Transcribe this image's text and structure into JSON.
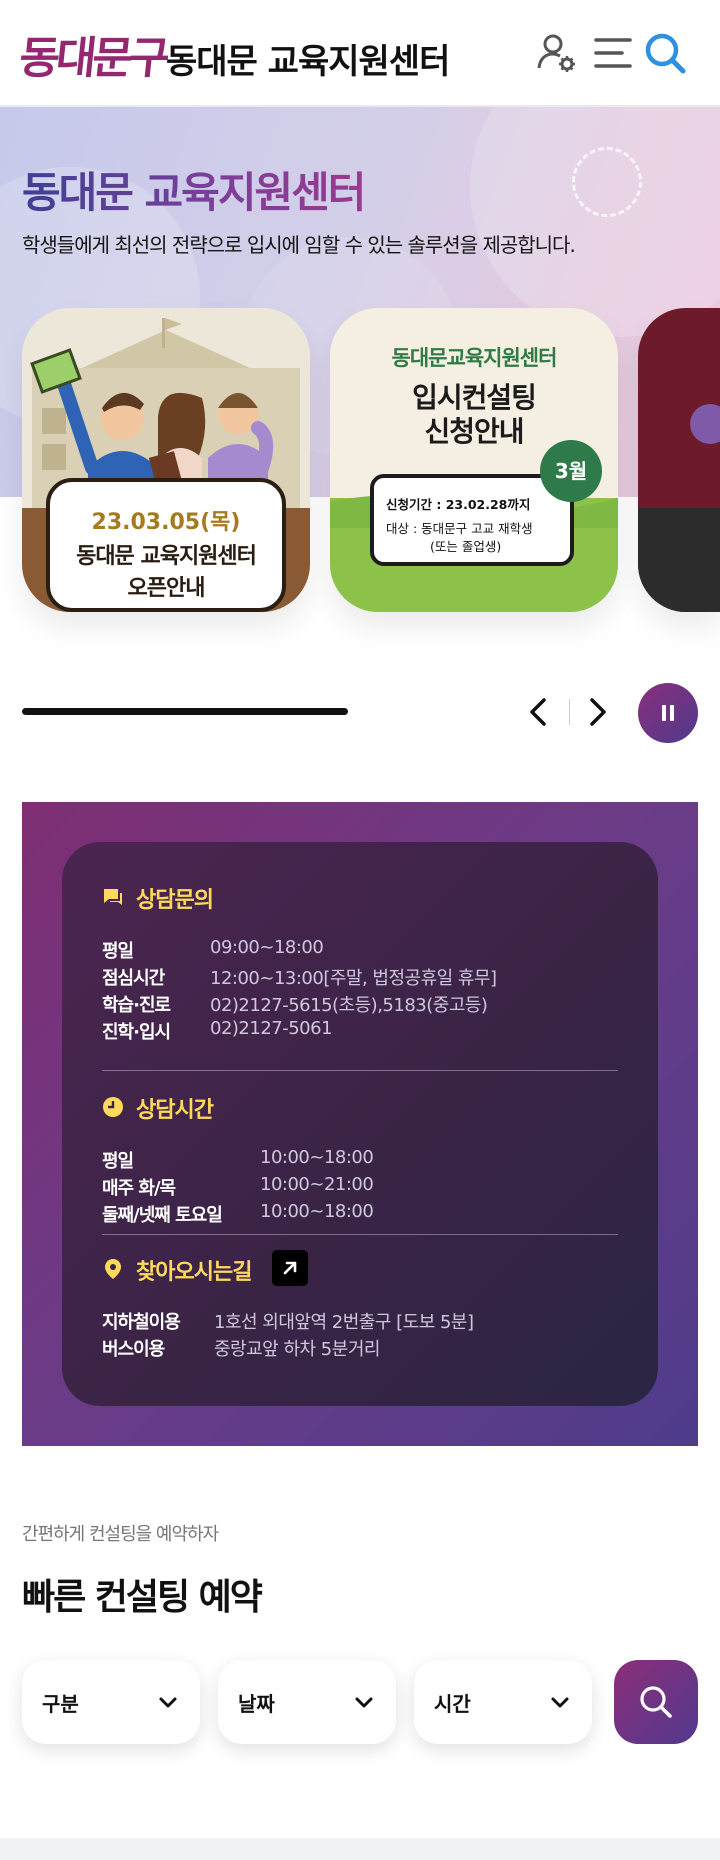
{
  "header": {
    "logo_text": "동대문구",
    "site_title": "동대문 교육지원센터",
    "icons": [
      "user-settings-icon",
      "menu-icon",
      "search-icon"
    ]
  },
  "hero": {
    "title": "동대문 교육지원센터",
    "subtitle": "학생들에게 최선의 전략으로 입시에 임할 수 있는 솔루션을 제공합니다.",
    "cards": [
      {
        "date": "23.03.05(목)",
        "line1": "동대문 교육지원센터",
        "line2": "오픈안내"
      },
      {
        "org": "동대문교육지원센터",
        "line1": "입시컨설팅",
        "line2": "신청안내",
        "month_badge": "3월",
        "period": "신청기간 : 23.02.28까지",
        "target": "대상 : 동대문구 고교 재학생",
        "target_note": "(또는 졸업생)"
      }
    ]
  },
  "slider": {
    "progress": 0.48,
    "icons": [
      "chevron-left-icon",
      "chevron-right-icon",
      "pause-icon"
    ]
  },
  "info": {
    "consult": {
      "title": "상담문의",
      "rows": [
        {
          "label": "평일",
          "value": "09:00~18:00"
        },
        {
          "label": "점심시간",
          "value": "12:00~13:00[주말, 법정공휴일 휴무]"
        },
        {
          "label": "학습·진로",
          "value": "02)2127-5615(초등),5183(중고등)"
        },
        {
          "label": "진학·입시",
          "value": "02)2127-5061"
        }
      ]
    },
    "hours": {
      "title": "상담시간",
      "rows": [
        {
          "label": "평일",
          "value": "10:00~18:00"
        },
        {
          "label": "매주 화/목",
          "value": "10:00~21:00"
        },
        {
          "label": "둘째/넷째 토요일",
          "value": "10:00~18:00"
        }
      ]
    },
    "directions": {
      "title": "찾아오시는길",
      "rows": [
        {
          "label": "지하철이용",
          "value": "1호선 외대앞역 2번출구 [도보 5분]"
        },
        {
          "label": "버스이용",
          "value": "중랑교앞 하차 5분거리"
        }
      ]
    },
    "colors": {
      "accent": "#ffd95a",
      "brand": "#93286f"
    }
  },
  "reservation": {
    "subtitle": "간편하게 컨설팅을 예약하자",
    "title": "빠른 컨설팅 예약",
    "selects": [
      {
        "label": "구분"
      },
      {
        "label": "날짜"
      },
      {
        "label": "시간"
      }
    ]
  }
}
